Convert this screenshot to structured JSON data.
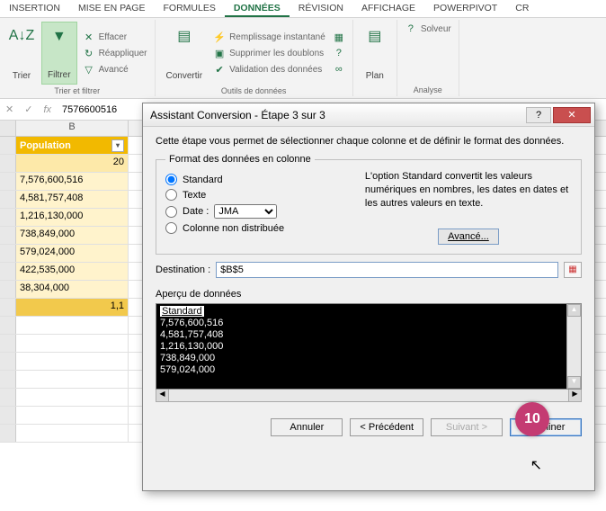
{
  "ribbon_tabs": {
    "insertion": "INSERTION",
    "mise_en_page": "MISE EN PAGE",
    "formules": "FORMULES",
    "donnees": "DONNÉES",
    "revision": "RÉVISION",
    "affichage": "AFFICHAGE",
    "powerpivot": "POWERPIVOT",
    "cr": "CR"
  },
  "ribbon": {
    "trier": "Trier",
    "filtrer": "Filtrer",
    "effacer": "Effacer",
    "reappliquer": "Réappliquer",
    "avance": "Avancé",
    "group1_label": "Trier et filtrer",
    "convertir": "Convertir",
    "remplissage": "Remplissage instantané",
    "supprimer_doublons": "Supprimer les doublons",
    "validation": "Validation des données",
    "group2_label": "Outils de données",
    "plan": "Plan",
    "solveur": "Solveur",
    "analyse": "Analyse"
  },
  "formula_bar": {
    "fx": "fx",
    "value": "7576600516"
  },
  "sheet": {
    "col_b": "B",
    "header": "Population",
    "filter_glyph": "▾",
    "subheader": "20",
    "rows": [
      "7,576,600,516",
      "4,581,757,408",
      "1,216,130,000",
      "738,849,000",
      "579,024,000",
      "422,535,000",
      "38,304,000"
    ],
    "total": "1,1"
  },
  "dialog": {
    "title": "Assistant Conversion - Étape 3 sur 3",
    "help_glyph": "?",
    "close_glyph": "✕",
    "intro": "Cette étape vous permet de sélectionner chaque colonne et de définir le format des données.",
    "fieldset_legend": "Format des données en colonne",
    "radio_standard": "Standard",
    "radio_texte": "Texte",
    "radio_date": "Date :",
    "date_value": "JMA",
    "radio_nondist": "Colonne non distribuée",
    "right_text": "L'option Standard convertit les valeurs numériques en nombres, les dates en dates et les autres valeurs en texte.",
    "advanced_btn": "Avancé...",
    "destination_label": "Destination :",
    "destination_value": "$B$5",
    "preview_label": "Aperçu de données",
    "preview_header": "Standard",
    "preview_rows": [
      "7,576,600,516",
      "4,581,757,408",
      "1,216,130,000",
      "738,849,000",
      "579,024,000"
    ],
    "btn_cancel": "Annuler",
    "btn_prev": "< Précédent",
    "btn_next": "Suivant >",
    "btn_finish": "Terminer"
  },
  "step_badge": "10"
}
